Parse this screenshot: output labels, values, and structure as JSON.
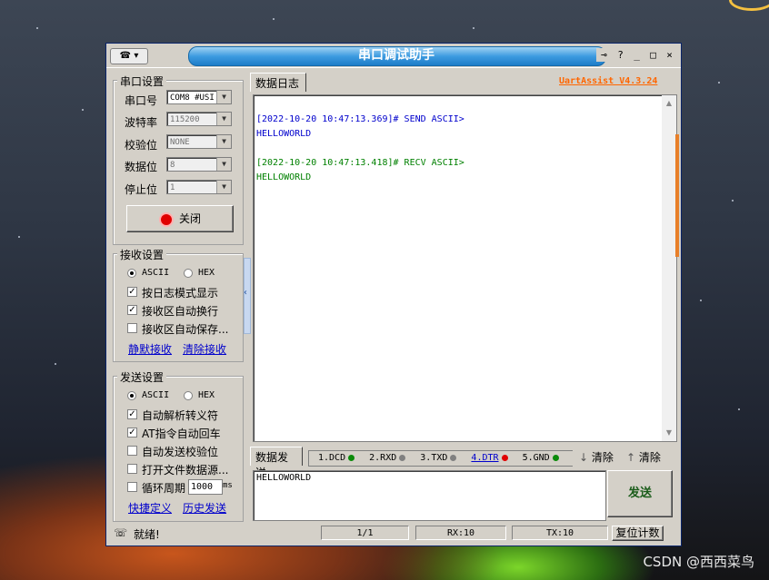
{
  "window": {
    "title": "串口调试助手",
    "sys_menu": "▾"
  },
  "serial_settings": {
    "title": "串口设置",
    "port": {
      "label": "串口号",
      "value": "COM8 #USI"
    },
    "baud": {
      "label": "波特率",
      "value": "115200"
    },
    "parity": {
      "label": "校验位",
      "value": "NONE"
    },
    "data_bits": {
      "label": "数据位",
      "value": "8"
    },
    "stop_bits": {
      "label": "停止位",
      "value": "1"
    },
    "open_button": "关闭"
  },
  "receive_settings": {
    "title": "接收设置",
    "ascii": "ASCII",
    "hex": "HEX",
    "options": [
      "按日志模式显示",
      "接收区自动换行",
      "接收区自动保存..."
    ],
    "links": [
      "静默接收",
      "清除接收"
    ]
  },
  "send_settings": {
    "title": "发送设置",
    "ascii": "ASCII",
    "hex": "HEX",
    "options": [
      "自动解析转义符",
      "AT指令自动回车",
      "自动发送校验位",
      "打开文件数据源...",
      "循环周期"
    ],
    "period": "1000",
    "period_unit": "ms",
    "links": [
      "快捷定义",
      "历史发送"
    ]
  },
  "log": {
    "tab": "数据日志",
    "brand": "UartAssist V4.3.24",
    "entries": [
      {
        "header": "[2022-10-20 10:47:13.369]# SEND ASCII>",
        "body": "HELLOWORLD"
      },
      {
        "header": "[2022-10-20 10:47:13.418]# RECV ASCII>",
        "body": "HELLOWORLD"
      }
    ]
  },
  "send": {
    "tab": "数据发送",
    "signals": [
      "1.DCD",
      "2.RXD",
      "3.TXD",
      "4.DTR",
      "5.GND",
      "6."
    ],
    "clear1": "清除",
    "clear2": "清除",
    "text": "HELLOWORLD",
    "button": "发送"
  },
  "status": {
    "text": "就绪!",
    "page": "1/1",
    "rx": "RX:10",
    "tx": "TX:10",
    "reset": "复位计数"
  },
  "watermark": "CSDN @西西菜鸟",
  "colors": {
    "send_text": "#0000cc",
    "recv_text": "#008000",
    "brand": "#ff6600",
    "title_bar": "#3d9be0"
  }
}
